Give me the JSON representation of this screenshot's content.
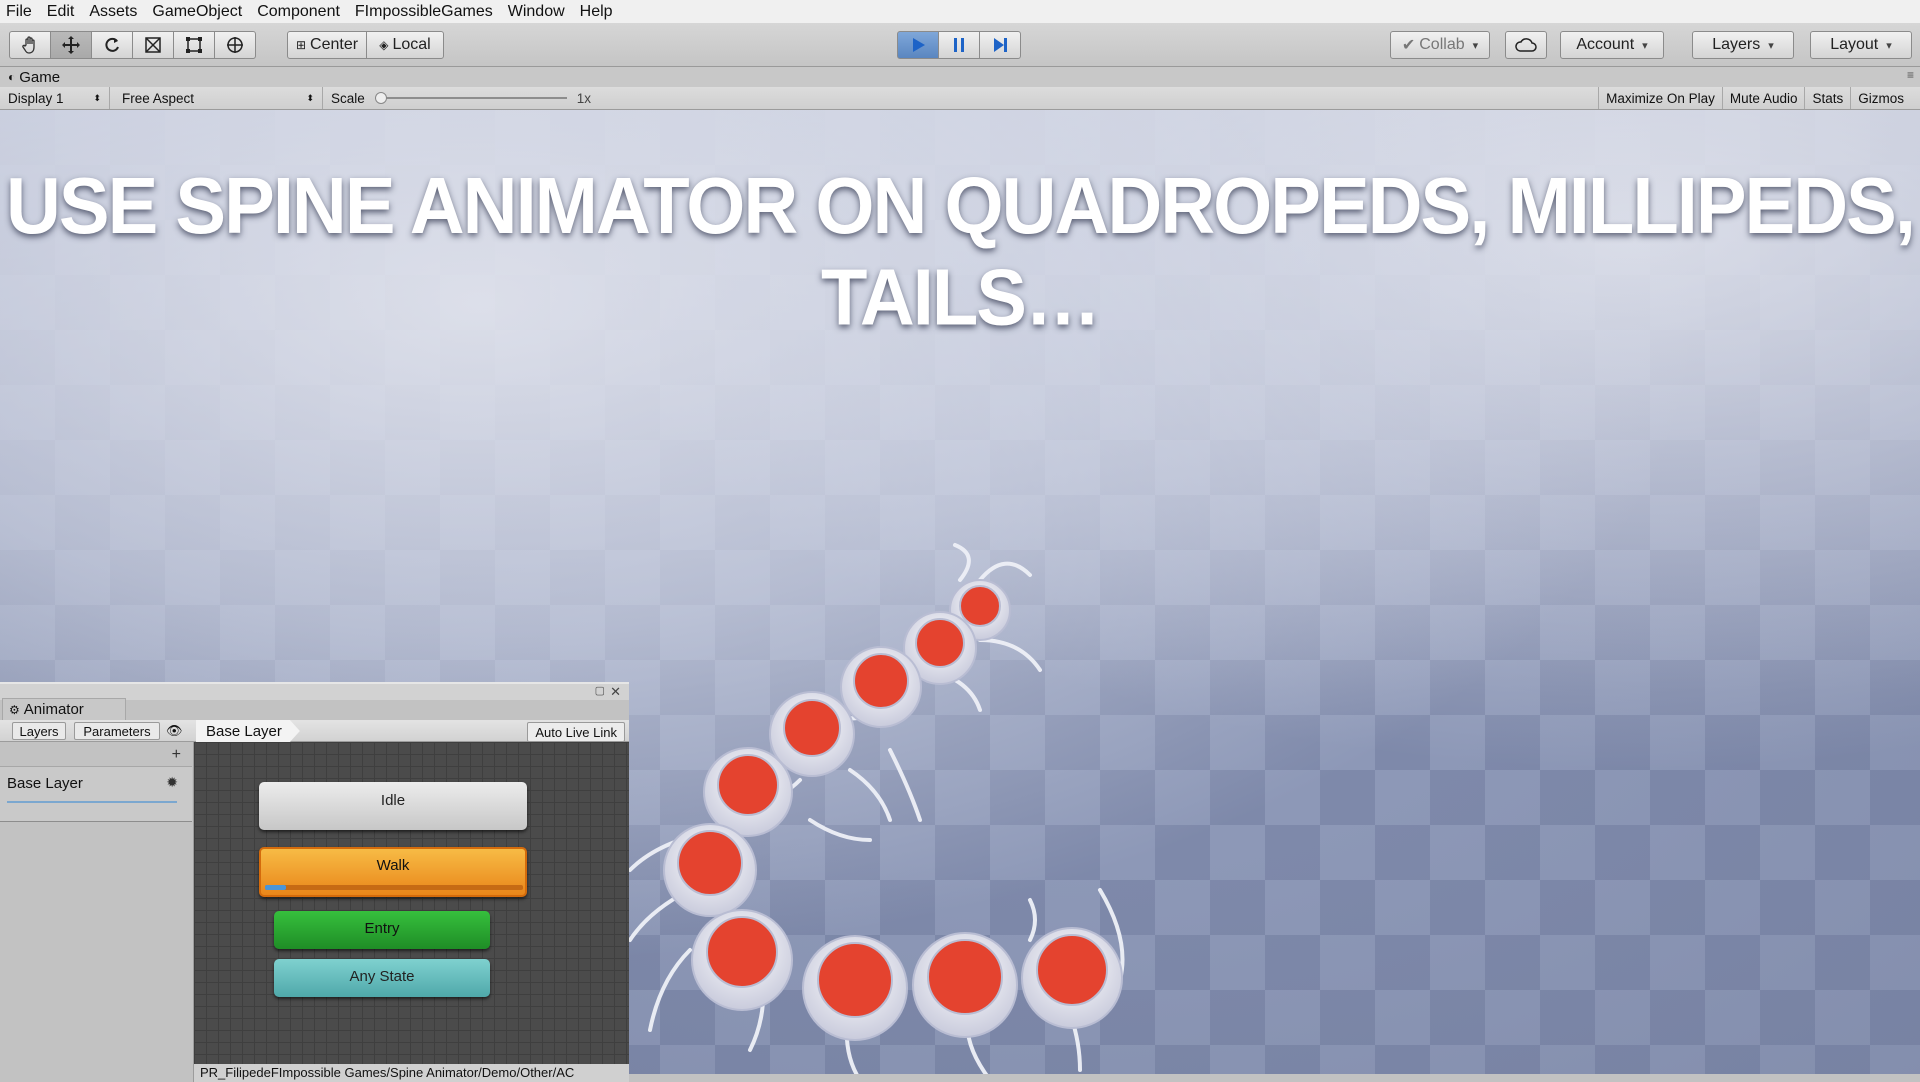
{
  "menu": [
    "File",
    "Edit",
    "Assets",
    "GameObject",
    "Component",
    "FImpossibleGames",
    "Window",
    "Help"
  ],
  "toolbar": {
    "tools": [
      {
        "name": "hand-tool-icon",
        "glyph": "✋"
      },
      {
        "name": "move-tool-icon",
        "glyph": "✥"
      },
      {
        "name": "rotate-tool-icon",
        "glyph": "⟳"
      },
      {
        "name": "scale-tool-icon",
        "glyph": "⤡"
      },
      {
        "name": "rect-tool-icon",
        "glyph": "⬚"
      },
      {
        "name": "transform-tool-icon",
        "glyph": "⊕"
      }
    ],
    "pivot_label": "Center",
    "space_label": "Local",
    "collab_label": "Collab",
    "account_label": "Account",
    "layers_label": "Layers",
    "layout_label": "Layout",
    "accent": "#5a86c0"
  },
  "game": {
    "tab_label": "Game",
    "display_label": "Display 1",
    "aspect_label": "Free Aspect",
    "scale_label": "Scale",
    "scale_value": "1x",
    "toggles": [
      "Maximize On Play",
      "Mute Audio",
      "Stats",
      "Gizmos"
    ],
    "headline": "USE SPINE ANIMATOR ON QUADROPEDS, MILLIPEDS, TAILS…"
  },
  "animator": {
    "tab_label": "Animator",
    "subtabs": [
      "Layers",
      "Parameters"
    ],
    "breadcrumb": "Base Layer",
    "auto_live_link": "Auto Live Link",
    "layer_name": "Base Layer",
    "states": {
      "idle": "Idle",
      "walk": "Walk",
      "entry": "Entry",
      "any": "Any State"
    },
    "walk_progress": 0.08,
    "path": "PR_FilipedeFImpossible Games/Spine Animator/Demo/Other/AC",
    "colors": {
      "walk": "#e9861a",
      "entry": "#1f8d26",
      "any": "#4fa8aa"
    }
  }
}
